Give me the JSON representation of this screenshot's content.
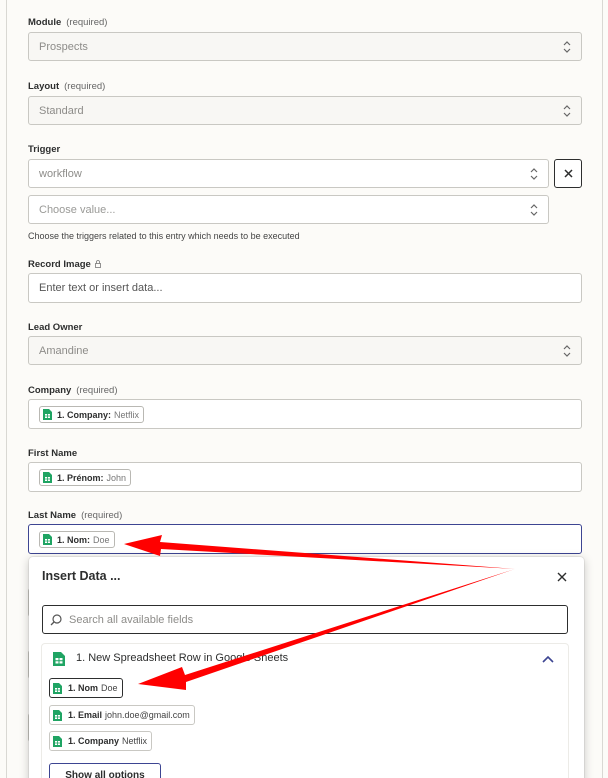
{
  "form": {
    "module": {
      "label": "Module",
      "required": "(required)",
      "value": "Prospects"
    },
    "layout": {
      "label": "Layout",
      "required": "(required)",
      "value": "Standard"
    },
    "trigger": {
      "label": "Trigger",
      "value": "workflow",
      "second_placeholder": "Choose value...",
      "helper": "Choose the triggers related to this entry which needs to be executed"
    },
    "record_image": {
      "label": "Record Image",
      "placeholder": "Enter text or insert data..."
    },
    "lead_owner": {
      "label": "Lead Owner",
      "value": "Amandine"
    },
    "company": {
      "label": "Company",
      "required": "(required)",
      "pill_label": "1. Company:",
      "pill_value": "Netflix"
    },
    "first_name": {
      "label": "First Name",
      "pill_label": "1. Prénom:",
      "pill_value": "John"
    },
    "last_name": {
      "label": "Last Name",
      "required": "(required)",
      "pill_label": "1. Nom:",
      "pill_value": "Doe"
    }
  },
  "insert_data": {
    "title": "Insert Data ...",
    "search_placeholder": "Search all available fields",
    "group_title": "1. New Spreadsheet Row in Google Sheets",
    "options": [
      {
        "label": "1. Nom",
        "value": "Doe"
      },
      {
        "label": "1. Email",
        "value": "john.doe@gmail.com"
      },
      {
        "label": "1. Company",
        "value": "Netflix"
      }
    ],
    "show_all_label": "Show all options"
  },
  "colors": {
    "sheets_green": "#1fa463",
    "focus_border": "#3d4592",
    "arrow_red": "#ff0000"
  }
}
